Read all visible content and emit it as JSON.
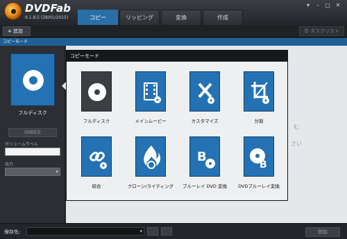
{
  "app": {
    "name": "DVDFab",
    "version": "9.1.8.5 (28/01/2015)"
  },
  "tabs": [
    {
      "label": "コピー",
      "active": true
    },
    {
      "label": "リッピング",
      "active": false
    },
    {
      "label": "変換",
      "active": false
    },
    {
      "label": "作成",
      "active": false
    }
  ],
  "toolbar": {
    "add_label": "追加",
    "add_symbol": "+",
    "tasklist_label": "タスクリスト"
  },
  "mode_bar": {
    "label": "コピーモード"
  },
  "left_panel": {
    "selected_mode": "フルディスク",
    "detail_button": "詳細設定",
    "volume_label": "ボリュームラベル",
    "volume_value": "",
    "output_label": "出力",
    "output_value": ""
  },
  "background_text": {
    "line1": "む",
    "line2": "さい"
  },
  "popup": {
    "title": "コピーモード",
    "modes": [
      {
        "label": "フルディスク",
        "icon": "disc-icon",
        "selected": true
      },
      {
        "label": "メインムービー",
        "icon": "film-icon",
        "selected": false
      },
      {
        "label": "カスタマイズ",
        "icon": "pencil-wrench-icon",
        "selected": false
      },
      {
        "label": "分割",
        "icon": "crop-icon",
        "selected": false
      },
      {
        "label": "結合",
        "icon": "link-icon",
        "selected": false
      },
      {
        "label": "クローン/ライティング",
        "icon": "flame-disc-icon",
        "selected": false
      },
      {
        "label": "ブルーレイ DVD 変換",
        "icon": "bluray-disc-icon",
        "selected": false
      },
      {
        "label": "DVDブルーレイ変換",
        "icon": "dvd-bluray-icon",
        "selected": false
      }
    ]
  },
  "footer": {
    "save_label": "保存先:",
    "save_value": "",
    "start_label": "開始"
  },
  "colors": {
    "accent": "#2472b4",
    "header": "#2a2d31",
    "tile_selected": "#3b3f44",
    "popup_bg": "#eeeff1"
  }
}
